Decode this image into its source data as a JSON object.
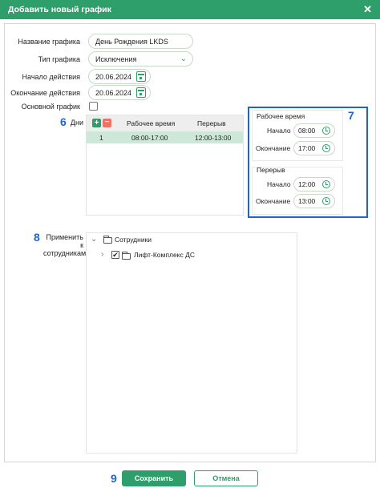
{
  "window": {
    "title": "Добавить новый график",
    "close_glyph": "✕"
  },
  "form": {
    "name_label": "Название графика",
    "name_value": "День Рождения LKDS",
    "type_label": "Тип графика",
    "type_value": "Исключения",
    "start_label": "Начало действия",
    "start_value": "20.06.2024",
    "end_label": "Окончание действия",
    "end_value": "20.06.2024",
    "main_label": "Основной график",
    "main_checked": false
  },
  "days": {
    "label": "Дни",
    "marker": "6",
    "columns": [
      "Рабочее время",
      "Перерыв"
    ],
    "rows": [
      {
        "num": "1",
        "work": "08:00-17:00",
        "break": "12:00-13:00"
      }
    ]
  },
  "details": {
    "marker": "7",
    "work_title": "Рабочее время",
    "work_start_label": "Начало",
    "work_start_value": "08:00",
    "work_end_label": "Окончание",
    "work_end_value": "17:00",
    "break_title": "Перерыв",
    "break_start_label": "Начало",
    "break_start_value": "12:00",
    "break_end_label": "Окончание",
    "break_end_value": "13:00"
  },
  "apply": {
    "marker": "8",
    "label": "Применить к сотрудникам",
    "tree": [
      {
        "label": "Сотрудники",
        "expanded": true
      },
      {
        "label": "Лифт-Комплекс ДС",
        "checked": true
      }
    ]
  },
  "footer": {
    "marker": "9",
    "save_label": "Сохранить",
    "cancel_label": "Отмена"
  },
  "colors": {
    "accent": "#2e9e6a",
    "annotation": "#1a66d6",
    "danger": "#e8746a"
  }
}
